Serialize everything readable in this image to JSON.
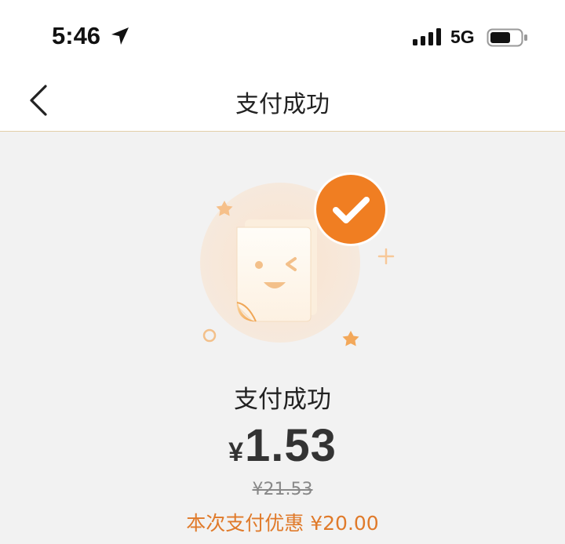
{
  "status_bar": {
    "time": "5:46",
    "network": "5G",
    "icons": [
      "location-arrow-icon",
      "signal-bars-icon",
      "battery-icon"
    ]
  },
  "nav": {
    "back_icon": "chevron-left-icon",
    "title": "支付成功"
  },
  "result": {
    "illustration": "payment-success-illustration",
    "badge_icon": "checkmark-icon",
    "title": "支付成功",
    "currency": "¥",
    "amount": "1.53",
    "original_price": "¥21.53",
    "discount_note": "本次支付优惠 ¥20.00"
  },
  "colors": {
    "accent_orange": "#f07e22",
    "discount_text": "#e07a2a",
    "page_background": "#f2f2f2"
  }
}
